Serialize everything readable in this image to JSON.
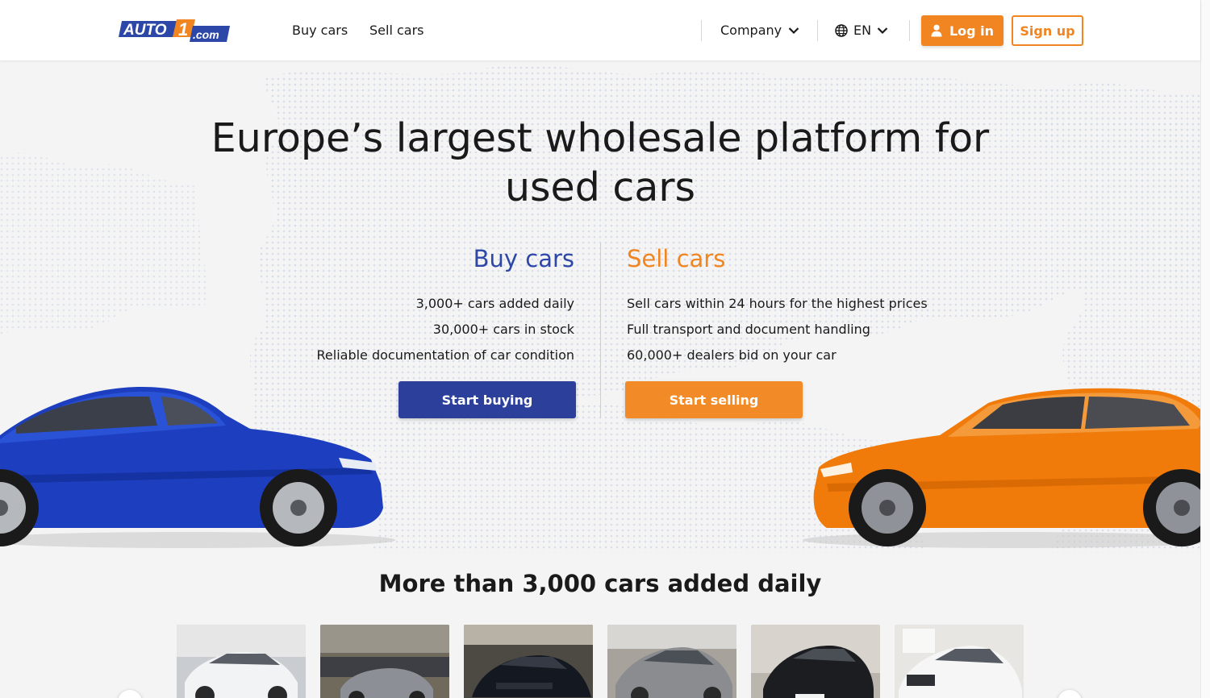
{
  "header": {
    "logo_text": "AUTO1.com",
    "nav": {
      "buy_cars": "Buy cars",
      "sell_cars": "Sell cars"
    },
    "company_label": "Company",
    "language_label": "EN",
    "login_label": "Log in",
    "signup_label": "Sign up"
  },
  "hero": {
    "title_line1": "Europe’s largest wholesale platform for",
    "title_line2": "used cars",
    "buy": {
      "title": "Buy cars",
      "items": [
        "3,000+ cars added daily",
        "30,000+ cars in stock",
        "Reliable documentation of car condition"
      ],
      "cta": "Start buying"
    },
    "sell": {
      "title": "Sell cars",
      "items": [
        "Sell cars within 24 hours for the highest prices",
        "Full transport and document handling",
        "60,000+ dealers bid on your car"
      ],
      "cta": "Start selling"
    }
  },
  "listing": {
    "title": "More than 3,000 cars added daily",
    "thumbnails": [
      "white-suv-thumbnail",
      "grey-sedan-lot-thumbnail",
      "black-hatchback-thumbnail",
      "silver-coupe-thumbnail",
      "black-compact-thumbnail",
      "white-suv-showroom-thumbnail"
    ]
  },
  "colors": {
    "brand_orange": "#f08522",
    "brand_blue": "#2c47a7",
    "button_blue": "#2c3f9a"
  }
}
